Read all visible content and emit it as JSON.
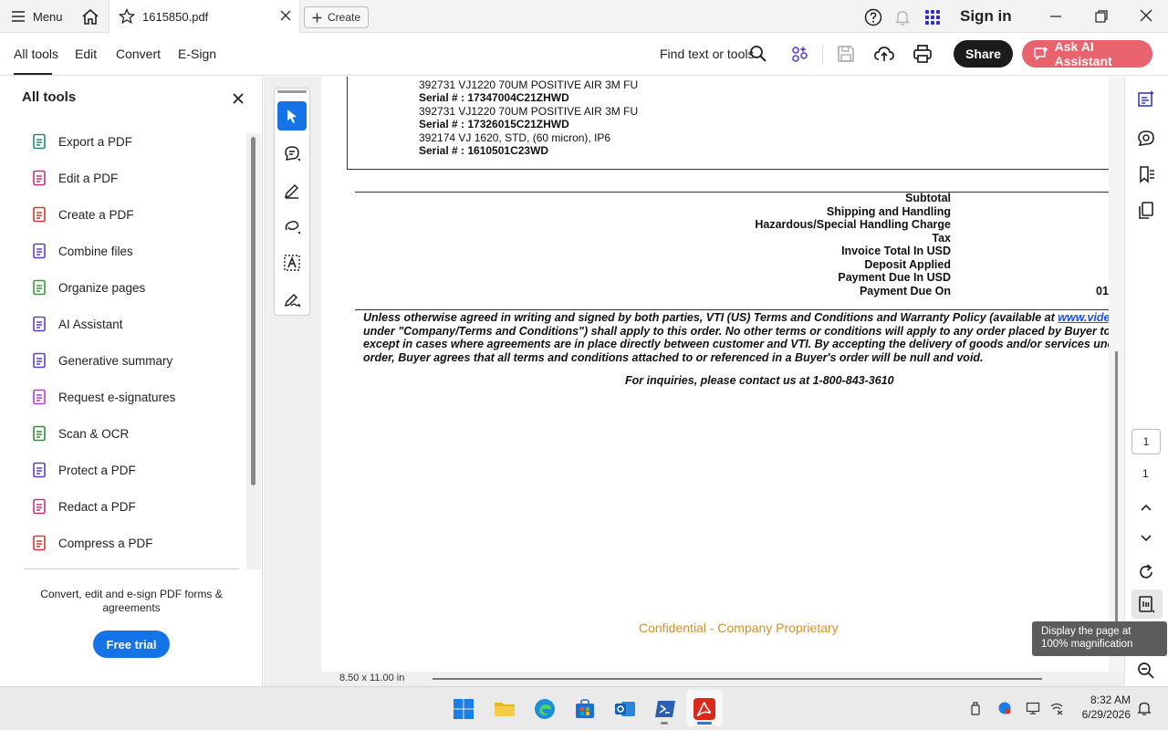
{
  "window": {
    "menu_label": "Menu",
    "tab_filename": "1615850.pdf",
    "create_label": "Create",
    "sign_in": "Sign in"
  },
  "toolbar": {
    "tabs": [
      "All tools",
      "Edit",
      "Convert",
      "E-Sign"
    ],
    "find_label": "Find text or tools",
    "share_label": "Share",
    "ai_label": "Ask AI Assistant"
  },
  "left_panel": {
    "title": "All tools",
    "tools": [
      {
        "label": "Export a PDF",
        "icon": "export-pdf-icon",
        "color": "#1f8a70"
      },
      {
        "label": "Edit a PDF",
        "icon": "edit-pdf-icon",
        "color": "#c2327a"
      },
      {
        "label": "Create a PDF",
        "icon": "create-pdf-icon",
        "color": "#d9342b"
      },
      {
        "label": "Combine files",
        "icon": "combine-files-icon",
        "color": "#5b3fd0"
      },
      {
        "label": "Organize pages",
        "icon": "organize-pages-icon",
        "color": "#3a9a3a"
      },
      {
        "label": "AI Assistant",
        "icon": "ai-assistant-icon",
        "color": "#5b3fd0"
      },
      {
        "label": "Generative summary",
        "icon": "generative-summary-icon",
        "color": "#5b3fd0"
      },
      {
        "label": "Request e-signatures",
        "icon": "request-esignatures-icon",
        "color": "#b23ad6"
      },
      {
        "label": "Scan & OCR",
        "icon": "scan-ocr-icon",
        "color": "#2e8b3a"
      },
      {
        "label": "Protect a PDF",
        "icon": "protect-pdf-icon",
        "color": "#5b3fd0"
      },
      {
        "label": "Redact a PDF",
        "icon": "redact-pdf-icon",
        "color": "#c2327a"
      },
      {
        "label": "Compress a PDF",
        "icon": "compress-pdf-icon",
        "color": "#d9342b"
      }
    ],
    "promo_text": "Convert, edit and e-sign PDF forms & agreements",
    "free_trial": "Free trial"
  },
  "document": {
    "items": [
      "392731 VJ1220 70UM POSITIVE AIR 3M FU",
      "Serial # :  17347004C21ZHWD",
      "392731 VJ1220 70UM POSITIVE AIR 3M FU",
      "Serial # :  17326015C21ZHWD",
      "392174 VJ 1620, STD, (60 micron), IP6",
      "Serial # :  1610501C23WD"
    ],
    "totals": [
      "Subtotal",
      "Shipping and Handling",
      "Hazardous/Special Handling Charge",
      "Tax",
      "Invoice Total In USD",
      "Deposit Applied",
      "Payment Due In USD",
      "Payment Due On"
    ],
    "payment_due_value": "01",
    "terms_lines": [
      "Unless otherwise agreed in writing and signed by both parties, VTI (US) Terms and Conditions and Warranty Policy (available at ",
      "under \"Company/Terms and Conditions\") shall apply to this order. No other terms or conditions will apply to any order placed by Buyer to VT",
      "except in cases where agreements are in place directly between customer and VTI. By accepting the delivery of goods and/or services under",
      "order, Buyer agrees that all terms and conditions attached to or referenced in a Buyer's order will be null and void."
    ],
    "terms_link": "www.videojet",
    "inquiry": "For inquiries, please contact us at 1-800-843-3610",
    "confidential": "Confidential - Company Proprietary",
    "page_size": "8.50 x 11.00 in"
  },
  "right_rail": {
    "page_number": "1",
    "page_total": "1",
    "tooltip": "Display the page at 100% magnification"
  },
  "taskbar": {
    "time": "8:32 AM",
    "date": "6/29/2026"
  }
}
